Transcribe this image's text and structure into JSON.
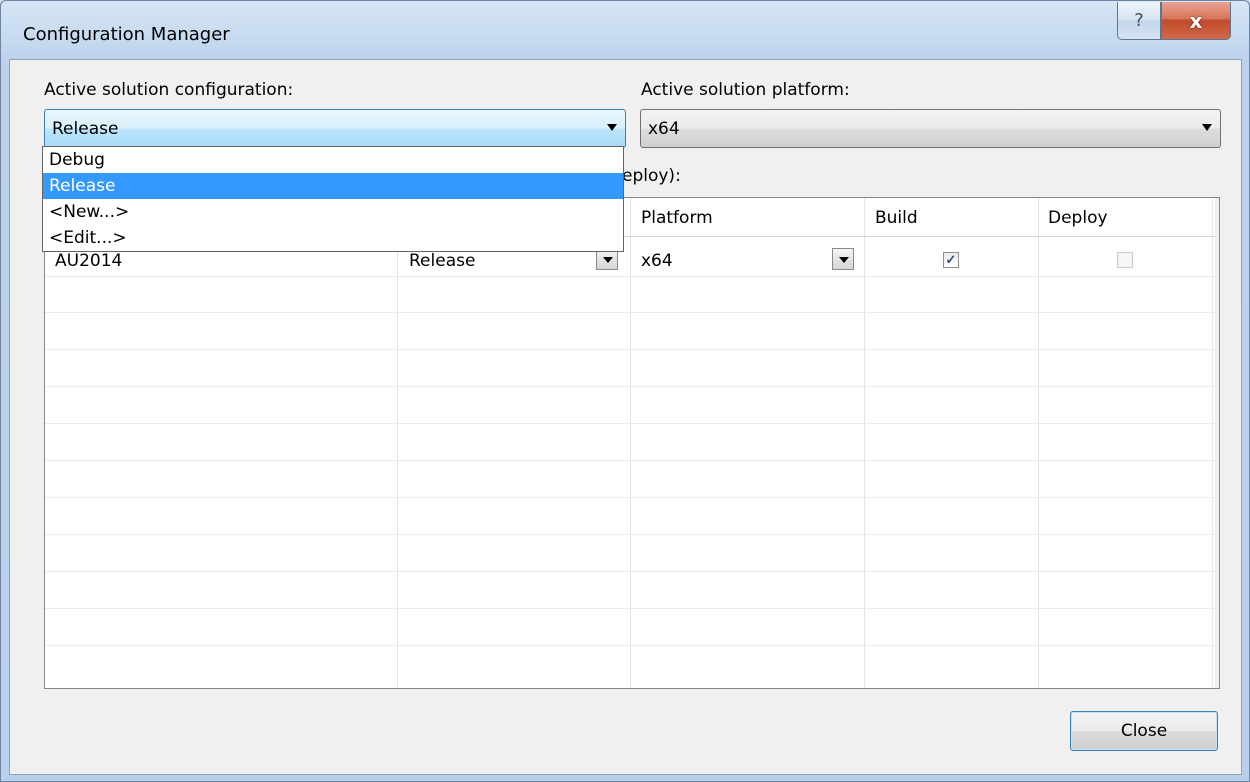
{
  "window": {
    "title": "Configuration Manager",
    "help_glyph": "?",
    "close_glyph": "x"
  },
  "config": {
    "label": "Active solution configuration:",
    "value": "Release",
    "options": [
      "Debug",
      "Release",
      "<New...>",
      "<Edit...>"
    ],
    "selected_index": 1
  },
  "platform": {
    "label": "Active solution platform:",
    "value": "x64"
  },
  "contexts": {
    "label_visible_fragment": "eploy):",
    "columns": [
      "Platform",
      "Build",
      "Deploy"
    ],
    "rows": [
      {
        "project": "AU2014",
        "configuration": "Release",
        "platform": "x64",
        "build": true,
        "deploy": false
      }
    ]
  },
  "buttons": {
    "close_label": "Close"
  },
  "colors": {
    "selection": "#3399ff",
    "close_x": "#c14a2b"
  }
}
